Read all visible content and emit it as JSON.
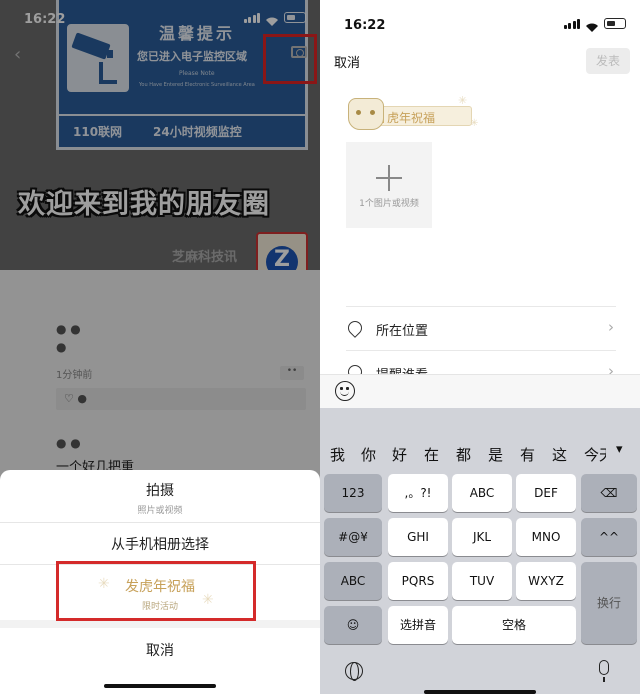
{
  "left": {
    "status": {
      "time": "16:22"
    },
    "cover": {
      "sign_title": "温馨提示",
      "sign_line1": "您已进入电子监控区域",
      "sign_note": "Please Note",
      "sign_note_en": "You Have Entered Electronic Surveillance Area",
      "sign_bottom_left": "110联网",
      "sign_bottom_right": "24小时视频监控",
      "caption": "欢迎来到我的朋友圈",
      "watermark": "芝麻科技讯"
    },
    "feed": {
      "post1_time": "1分钟前",
      "post2_text": "一个好几把重"
    },
    "sheet": {
      "shoot_label": "拍摄",
      "shoot_sub": "照片或视频",
      "album_label": "从手机相册选择",
      "blessing_label": "发虎年祝福",
      "blessing_sub": "限时活动",
      "cancel_label": "取消"
    }
  },
  "right": {
    "status": {
      "time": "16:22"
    },
    "header": {
      "cancel": "取消",
      "publish": "发表"
    },
    "tag_placeholder": "虎年祝福",
    "add_tile_label": "1个图片或视频",
    "rows": [
      {
        "label": "所在位置",
        "icon": "location-pin-icon"
      },
      {
        "label": "提醒谁看",
        "icon": "at-sign-icon"
      }
    ],
    "candidates": [
      "我",
      "你",
      "好",
      "在",
      "都",
      "是",
      "有",
      "这",
      "今天"
    ],
    "keys": {
      "r1": [
        "123",
        ",。?!",
        "ABC",
        "DEF"
      ],
      "r2": [
        "#@¥",
        "GHI",
        "JKL",
        "MNO",
        "^^"
      ],
      "r3": [
        "ABC",
        "PQRS",
        "TUV",
        "WXYZ"
      ],
      "r4": [
        "选拼音",
        "空格"
      ],
      "return": "换行"
    }
  },
  "colors": {
    "highlight_red": "#e02424",
    "gold": "#c7a15a"
  }
}
